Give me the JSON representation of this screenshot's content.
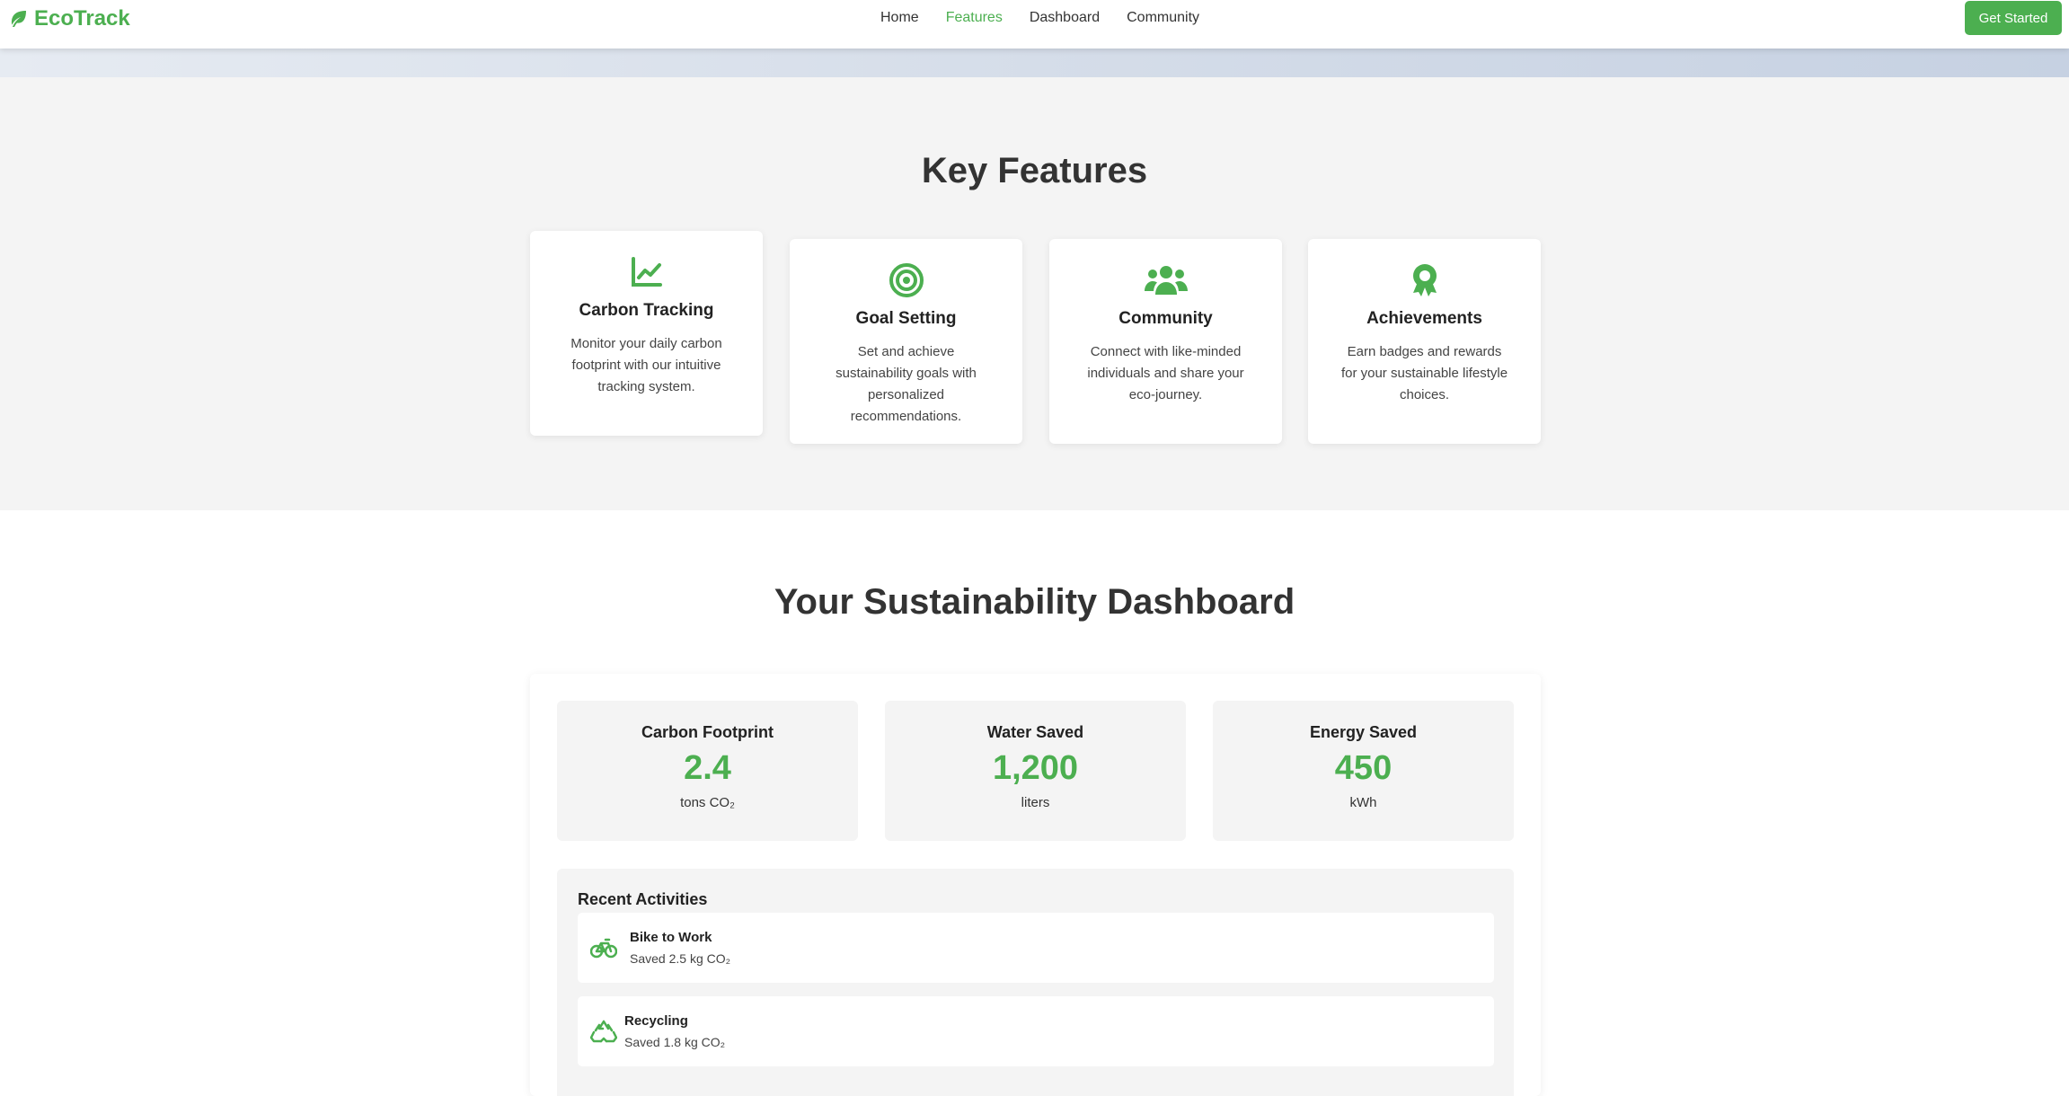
{
  "brand": {
    "name": "EcoTrack",
    "color": "#4caf50"
  },
  "nav": {
    "links": [
      {
        "label": "Home",
        "active": false
      },
      {
        "label": "Features",
        "active": true
      },
      {
        "label": "Dashboard",
        "active": false
      },
      {
        "label": "Community",
        "active": false
      }
    ],
    "cta_label": "Get Started"
  },
  "features": {
    "title": "Key Features",
    "cards": [
      {
        "icon": "chart-line-icon",
        "title": "Carbon Tracking",
        "description": "Monitor your daily carbon footprint with our intuitive tracking system."
      },
      {
        "icon": "target-icon",
        "title": "Goal Setting",
        "description": "Set and achieve sustainability goals with personalized recommendations."
      },
      {
        "icon": "users-icon",
        "title": "Community",
        "description": "Connect with like-minded individuals and share your eco-journey."
      },
      {
        "icon": "award-icon",
        "title": "Achievements",
        "description": "Earn badges and rewards for your sustainable lifestyle choices."
      }
    ]
  },
  "dashboard": {
    "title": "Your Sustainability Dashboard",
    "stats": [
      {
        "label": "Carbon Footprint",
        "value": "2.4",
        "unit": "tons CO₂"
      },
      {
        "label": "Water Saved",
        "value": "1,200",
        "unit": "liters"
      },
      {
        "label": "Energy Saved",
        "value": "450",
        "unit": "kWh"
      }
    ],
    "activities_title": "Recent Activities",
    "activities": [
      {
        "icon": "bicycle-icon",
        "name": "Bike to Work",
        "detail": "Saved 2.5 kg CO₂"
      },
      {
        "icon": "recycle-icon",
        "name": "Recycling",
        "detail": "Saved 1.8 kg CO₂"
      }
    ]
  }
}
